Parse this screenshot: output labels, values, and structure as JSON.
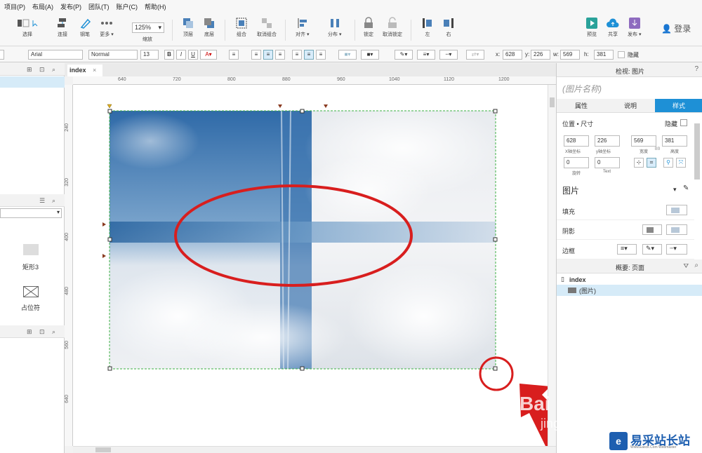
{
  "menu": [
    "项目(P)",
    "布局(A)",
    "发布(P)",
    "团队(T)",
    "账户(C)",
    "帮助(H)"
  ],
  "toolbar": {
    "select": "选择",
    "connect": "连接",
    "pen": "钢笔",
    "more": "更多 ▾",
    "zoom_value": "125%",
    "zoom_label": "缩放",
    "top": "顶层",
    "bottom": "底层",
    "group": "组合",
    "ungroup": "取消组合",
    "align": "对齐 ▾",
    "distribute": "分布 ▾",
    "lock": "锁定",
    "unlock": "取消锁定",
    "left": "左",
    "right": "右",
    "preview": "预览",
    "share": "共享",
    "publish": "发布 ▾",
    "login": "登录"
  },
  "format": {
    "font": "Arial",
    "style": "Normal",
    "size": "13",
    "x_label": "x:",
    "x": "628",
    "y_label": "y:",
    "y": "226",
    "w_label": "w:",
    "w": "569",
    "h_label": "h:",
    "h": "381",
    "hidden_label": "隐藏"
  },
  "left_panel": {
    "widget_rect": "矩形3",
    "widget_placeholder": "占位符"
  },
  "canvas": {
    "tab": "index",
    "ruler_h": [
      "640",
      "720",
      "800",
      "880",
      "960",
      "1040",
      "1120",
      "1200"
    ],
    "ruler_v": [
      "240",
      "320",
      "400",
      "480",
      "560",
      "640"
    ]
  },
  "right_panel": {
    "header": "检视: 图片",
    "name_placeholder": "(图片名称)",
    "tabs": [
      "属性",
      "说明",
      "样式"
    ],
    "position_size": "位置 • 尺寸",
    "hidden": "隐藏",
    "x": "628",
    "y": "226",
    "w": "569",
    "h": "381",
    "x_label": "X轴坐标",
    "y_label": "y轴坐标",
    "w_label": "宽度",
    "h_label": "高度",
    "rotate": "0",
    "rotate_label": "旋转",
    "text_rotate": "0",
    "text_label": "Text",
    "section_title": "图片",
    "fill": "填充",
    "shadow": "阴影",
    "border": "边框",
    "outline_header": "概要: 页面",
    "outline_page": "index",
    "outline_item": "(图片)"
  },
  "watermark": {
    "baidu": "Bai",
    "jingyan": "jingyan",
    "site": "易采站长站",
    "site_sub": "Www.Easck.Com Webmaster"
  },
  "colors": {
    "accent": "#1e90d6",
    "annotation_red": "#d81e1e",
    "selection_green": "#3cb043"
  }
}
